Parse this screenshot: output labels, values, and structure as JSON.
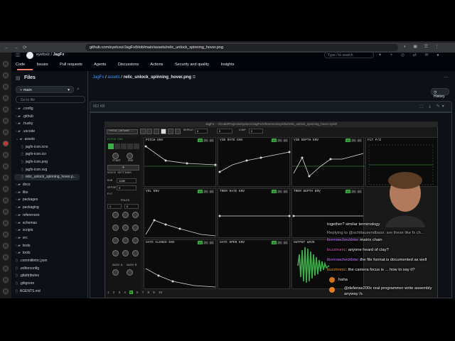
{
  "browser": {
    "url": "github.com/eyetcez/JagFx/blob/main/assets/relic_unlock_spinning_hover.png"
  },
  "header": {
    "owner": "eyetcez",
    "repo": "JagFx",
    "search_placeholder": "Type / to search"
  },
  "repo_nav": [
    "Code",
    "Issues",
    "Pull requests",
    "Agents",
    "Discussions",
    "Actions",
    "Security and quality",
    "Insights"
  ],
  "sidebar": {
    "title": "Files",
    "branch": "main",
    "goto_placeholder": "Go to file",
    "tree": [
      {
        "name": ".config",
        "type": "dir"
      },
      {
        "name": ".github",
        "type": "dir"
      },
      {
        "name": ".husky",
        "type": "dir"
      },
      {
        "name": ".vscode",
        "type": "dir"
      },
      {
        "name": "assets",
        "type": "dir-open"
      },
      {
        "name": "jagfx-icon.icns",
        "type": "file",
        "indent": 1
      },
      {
        "name": "jagfx-icon.ico",
        "type": "file",
        "indent": 1
      },
      {
        "name": "jagfx-icon.png",
        "type": "file",
        "indent": 1
      },
      {
        "name": "jagfx-icon.svg",
        "type": "file",
        "indent": 1
      },
      {
        "name": "relic_unlock_spinning_hover.p...",
        "type": "file",
        "indent": 1
      },
      {
        "name": "docs",
        "type": "dir"
      },
      {
        "name": "libs",
        "type": "dir"
      },
      {
        "name": "packages",
        "type": "dir"
      },
      {
        "name": "packaging",
        "type": "dir"
      },
      {
        "name": "references",
        "type": "dir"
      },
      {
        "name": "schemas",
        "type": "dir"
      },
      {
        "name": "scripts",
        "type": "dir"
      },
      {
        "name": "src",
        "type": "dir"
      },
      {
        "name": "tests",
        "type": "dir"
      },
      {
        "name": "tools",
        "type": "dir"
      },
      {
        "name": ".commitlintrc.json",
        "type": "file"
      },
      {
        "name": ".editorconfig",
        "type": "file"
      },
      {
        "name": ".gitattributes",
        "type": "file"
      },
      {
        "name": ".gitignore",
        "type": "file"
      },
      {
        "name": "AGENTS.md",
        "type": "file"
      }
    ]
  },
  "breadcrumb": {
    "repo": "JagFx",
    "folder": "assets",
    "file": "relic_unlock_spinning_hover.png"
  },
  "history_label": "History",
  "file_size": "652 KB",
  "synth": {
    "title": "JagFx - ~/Code/Projects/eyetcez/JagFx/references/synths/relic_unlock_spinning_hover.synth",
    "preset": "relic_unlock...",
    "toolbar": [
      "REPEAT",
      "0",
      "0",
      "LOOP",
      "0"
    ],
    "left_labels": [
      "PITCH ENV",
      "START",
      "END",
      "VOICE SETTINGS",
      "DUR",
      "1280",
      "OFFSET",
      "0",
      "FLT",
      "POLES",
      "1",
      "0",
      "GAIN A",
      "GAIN B"
    ],
    "panels": [
      {
        "title": "PITCH ENV"
      },
      {
        "title": "VIB RATE ENV"
      },
      {
        "title": "VIB DEPTH ENV"
      },
      {
        "title": "FLT P/Z"
      },
      {
        "title": "VOL ENV"
      },
      {
        "title": "TREM RATE ENV"
      },
      {
        "title": "TREM DEPTH ENV"
      },
      {
        "title": "GATE CLOSED ENV"
      },
      {
        "title": "GATE OPEN ENV"
      },
      {
        "title": "OUTPUT WAVE"
      }
    ],
    "panel_buttons": [
      "1X",
      "2X",
      "4X"
    ],
    "status": [
      "1",
      "2",
      "3",
      "4",
      "5",
      "6",
      "7",
      "8",
      "9",
      "10"
    ]
  },
  "chat": [
    {
      "text": "together? similar terminology"
    },
    {
      "text": "Replying to @achttausendbass: are these like fx ch..."
    },
    {
      "user": "iborrowcheckbtw",
      "msg": "matrix chain"
    },
    {
      "user": "buzztronic",
      "msg": "anyone heard of clay?"
    },
    {
      "user": "iborrowcheckbtw",
      "msg": "the file format is documented as well"
    },
    {
      "user": "buzztronic",
      "msg": "the camera focus is ... how to say it?"
    },
    {
      "text": "haha"
    },
    {
      "text": "@defense200x real programmer write assembly"
    },
    {
      "text": "anyway /s"
    }
  ],
  "colors": {
    "accent": "#4493f8",
    "tab_underline": "#f78166",
    "synth_green": "#3fae4a",
    "envelope": "#d8d8d8"
  }
}
